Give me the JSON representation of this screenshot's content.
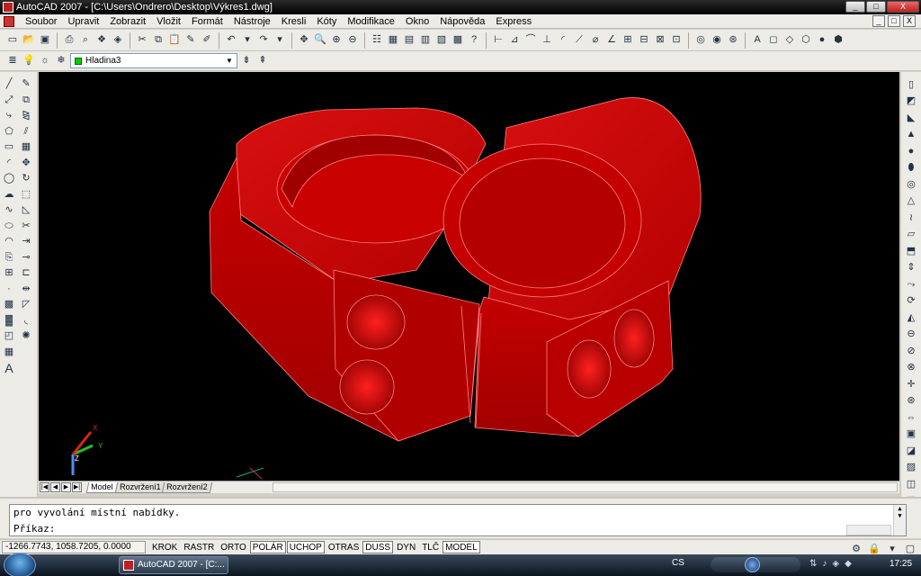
{
  "window": {
    "title": "AutoCAD 2007 - [C:\\Users\\Ondrero\\Desktop\\Výkres1.dwg]",
    "buttons": {
      "minimize": "_",
      "maximize": "□",
      "close": "X"
    }
  },
  "menu": {
    "items": [
      "Soubor",
      "Upravit",
      "Zobrazit",
      "Vložit",
      "Formát",
      "Nástroje",
      "Kresli",
      "Kóty",
      "Modifikace",
      "Okno",
      "Nápověda",
      "Express"
    ],
    "mdi_buttons": [
      "_",
      "□",
      "X"
    ]
  },
  "layer_toolbar": {
    "current_layer": "Hladina3",
    "layer_color": "#00c000"
  },
  "layout_tabs": {
    "nav": [
      "|◀",
      "◀",
      "▶",
      "▶|"
    ],
    "tabs": [
      "Model",
      "Rozvržení1",
      "Rozvržení2"
    ],
    "active": "Model"
  },
  "command": {
    "history_line": "pro vyvolání místní nabídky.",
    "prompt": "Příkaz:"
  },
  "status": {
    "coordinates": "-1266.7743, 1058.7205, 0.0000",
    "toggles": [
      {
        "label": "KROK",
        "on": false
      },
      {
        "label": "RASTR",
        "on": false
      },
      {
        "label": "ORTO",
        "on": false
      },
      {
        "label": "POLÁR",
        "on": true
      },
      {
        "label": "UCHOP",
        "on": true
      },
      {
        "label": "OTRAS",
        "on": false
      },
      {
        "label": "DUSS",
        "on": true
      },
      {
        "label": "DYN",
        "on": false
      },
      {
        "label": "TLČ",
        "on": false
      },
      {
        "label": "MODEL",
        "on": true
      }
    ]
  },
  "ucs": {
    "x_label": "X",
    "y_label": "Y",
    "z_label": "Z"
  },
  "taskbar": {
    "task_button": "AutoCAD 2007 - [C:...",
    "language": "CS",
    "clock": "17:25"
  },
  "colors": {
    "model_face": "#c00000",
    "model_edge": "#ff8080",
    "viewport_bg": "#000000"
  }
}
